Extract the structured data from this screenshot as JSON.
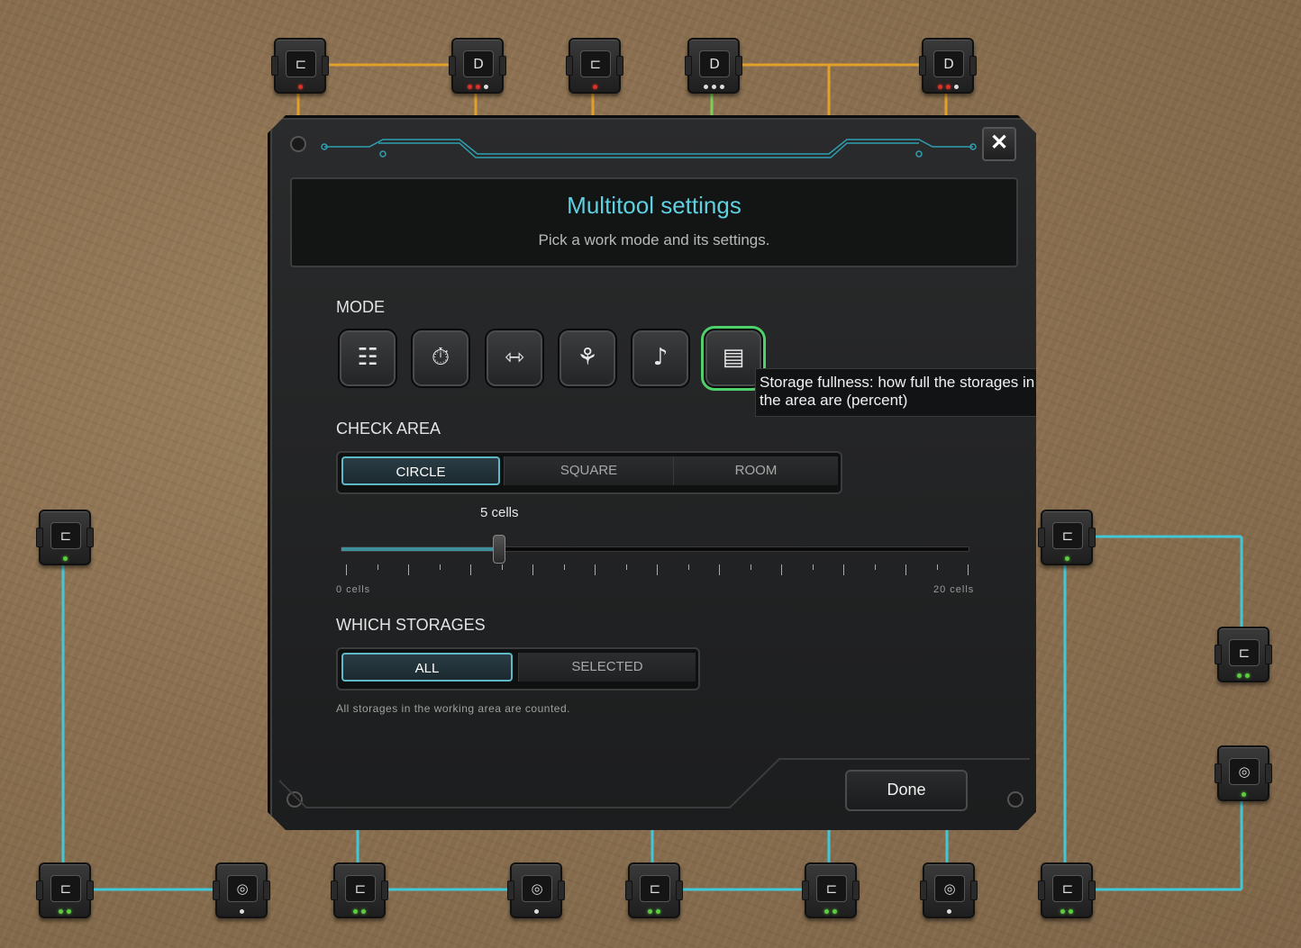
{
  "dialog": {
    "title": "Multitool settings",
    "subtitle": "Pick a work mode and its settings.",
    "close_symbol": "✕"
  },
  "mode": {
    "label": "MODE",
    "buttons": [
      {
        "name": "mode-list-sort-icon",
        "glyph": "☷"
      },
      {
        "name": "mode-timer-icon",
        "glyph": "⏱"
      },
      {
        "name": "mode-door-icon",
        "glyph": "⇿"
      },
      {
        "name": "mode-plant-icon",
        "glyph": "⚘"
      },
      {
        "name": "mode-sound-icon",
        "glyph": "♪"
      },
      {
        "name": "mode-storage-icon",
        "glyph": "▤"
      }
    ],
    "selected_index": 5,
    "tooltip": "Storage fullness: how full the storages in the area are (percent)"
  },
  "check_area": {
    "label": "CHECK AREA",
    "options": [
      "CIRCLE",
      "SQUARE",
      "ROOM"
    ],
    "selected": "CIRCLE"
  },
  "radius": {
    "value_label": "5 cells",
    "value": 5,
    "min": 0,
    "max": 20,
    "min_label": "0 cells",
    "max_label": "20 cells"
  },
  "which_storages": {
    "label": "WHICH STORAGES",
    "options": [
      "ALL",
      "SELECTED"
    ],
    "selected": "ALL",
    "description": "All storages in the working area are counted."
  },
  "done_label": "Done",
  "colors": {
    "accent": "#5fd0e0",
    "selected_mode": "#4ed06a",
    "wire_orange": "#e0a02a",
    "wire_cyan": "#40c8d8"
  },
  "gates": [
    {
      "name": "gate-top-1",
      "glyph": "⊏"
    },
    {
      "name": "gate-top-2",
      "glyph": "D"
    },
    {
      "name": "gate-top-3",
      "glyph": "⊏"
    },
    {
      "name": "gate-top-4",
      "glyph": "D"
    },
    {
      "name": "gate-top-5",
      "glyph": "D"
    },
    {
      "name": "gate-left-1",
      "glyph": "⊏"
    },
    {
      "name": "gate-right-1",
      "glyph": "⊏"
    },
    {
      "name": "gate-right-2",
      "glyph": "⊏"
    },
    {
      "name": "gate-right-3",
      "glyph": "◎"
    },
    {
      "name": "gate-bottom-1",
      "glyph": "⊏"
    },
    {
      "name": "gate-bottom-2",
      "glyph": "◎"
    },
    {
      "name": "gate-bottom-3",
      "glyph": "⊏"
    },
    {
      "name": "gate-bottom-4",
      "glyph": "◎"
    },
    {
      "name": "gate-bottom-5",
      "glyph": "⊏"
    },
    {
      "name": "gate-bottom-6",
      "glyph": "⊏"
    },
    {
      "name": "gate-bottom-7",
      "glyph": "◎"
    },
    {
      "name": "gate-bottom-8",
      "glyph": "⊏"
    }
  ]
}
